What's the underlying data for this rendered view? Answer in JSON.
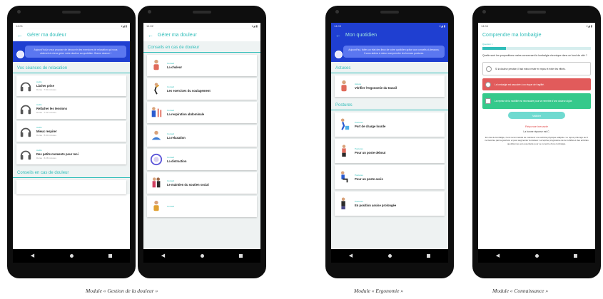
{
  "phones": {
    "p1": {
      "status_time": "14:01",
      "status_right": "▾◢ ▮",
      "title": "Gérer ma douleur",
      "bubble": "Aujourd'hui je vous propose de découvrir des exercices de relaxation qui vous aideront à mieux gérer votre douleur au quotidien. Bonne séance !",
      "section1": "Vos séances de relaxation",
      "cards": [
        {
          "kind": "Audio",
          "title": "Lâcher prise",
          "sub": "Durée : 7:04 minutes"
        },
        {
          "kind": "Audio",
          "title": "Relâcher les tensions",
          "sub": "Durée : 7:32 minutes"
        },
        {
          "kind": "Audio",
          "title": "Mieux respirer",
          "sub": "Durée : 5:34 minutes"
        },
        {
          "kind": "Audio",
          "title": "Des petits moments pour moi",
          "sub": "Durée : 6:28 minutes"
        }
      ],
      "section2": "Conseils en cas de douleur"
    },
    "p2": {
      "status_time": "14:02",
      "status_right": "▾◢ ▮",
      "title": "Gérer ma douleur",
      "section": "Conseils en cas de douleur",
      "cards": [
        {
          "kind": "Conseil",
          "title": "La chaleur"
        },
        {
          "kind": "Conseil",
          "title": "Les exercices du soulagement"
        },
        {
          "kind": "Conseil",
          "title": "La respiration abdominale"
        },
        {
          "kind": "Conseil",
          "title": "La relaxation"
        },
        {
          "kind": "Conseil",
          "title": "La distraction"
        },
        {
          "kind": "Conseil",
          "title": "Le maintien du soutien social"
        },
        {
          "kind": "Conseil",
          "title": ""
        }
      ]
    },
    "p3": {
      "status_time": "14:03",
      "status_right": "▾◢ ▮",
      "title": "Mon quotidien",
      "bubble": "Aujourd'hui, faites un état des lieux de votre quotidien grâce aux conseils ci-dessous. Il vous aidera à mieux comprendre les bonnes postures.",
      "section1": "Astuces",
      "card1": {
        "kind": "Astuce",
        "title": "Vérifier l'ergonomie du travail"
      },
      "section2": "Postures",
      "cards": [
        {
          "kind": "Postures",
          "title": "Port de charge lourde"
        },
        {
          "kind": "Postures",
          "title": "Pour un poste debout"
        },
        {
          "kind": "Postures",
          "title": "Pour un poste assis"
        },
        {
          "kind": "Postures",
          "title": "En position assise prolongée"
        }
      ]
    },
    "p4": {
      "status_time": "14:04",
      "status_right": "▾◢ ▮",
      "title": "Comprendre ma lombalgie",
      "progress_label": "Question 1",
      "progress": 0.22,
      "question": "Quelle sont les propositions vraies concernant la lombalgie chronique dans ce fond de cité ?",
      "options": [
        {
          "text": "Si la douleur persiste, il faut mieux rester en repos et éviter les efforts.",
          "state": "neutral"
        },
        {
          "text": "La lombalgie est associée à un risque de fragilité.",
          "state": "wrong"
        },
        {
          "text": "La reprise de la mobilité est nécessaire pour se remettre d'une douleur aigüe.",
          "state": "right"
        }
      ],
      "validate": "Valider",
      "expl_title": "Réponse inexacte",
      "expl_sub": "La bonne réponse est C.",
      "expl_body": "En cas de lombalgie, il est recommandé de maintenir une activité physique adaptée. Le repos prolongé au lit ne favorise pas la guérison et peut augmenter la douleur. La reprise progressive de la mobilité et des activités quotidiennes est essentielle pour se remettre d'une lombalgie."
    }
  },
  "captions": {
    "c1": "Module « Gestion de la douleur »",
    "c2": "Module « Ergonomie »",
    "c3": "Module « Connaissance »"
  },
  "colors": {
    "accent": "#2fbdb9",
    "blue": "#1f3fd1",
    "wrong": "#e15b5b",
    "right": "#35c98b"
  }
}
